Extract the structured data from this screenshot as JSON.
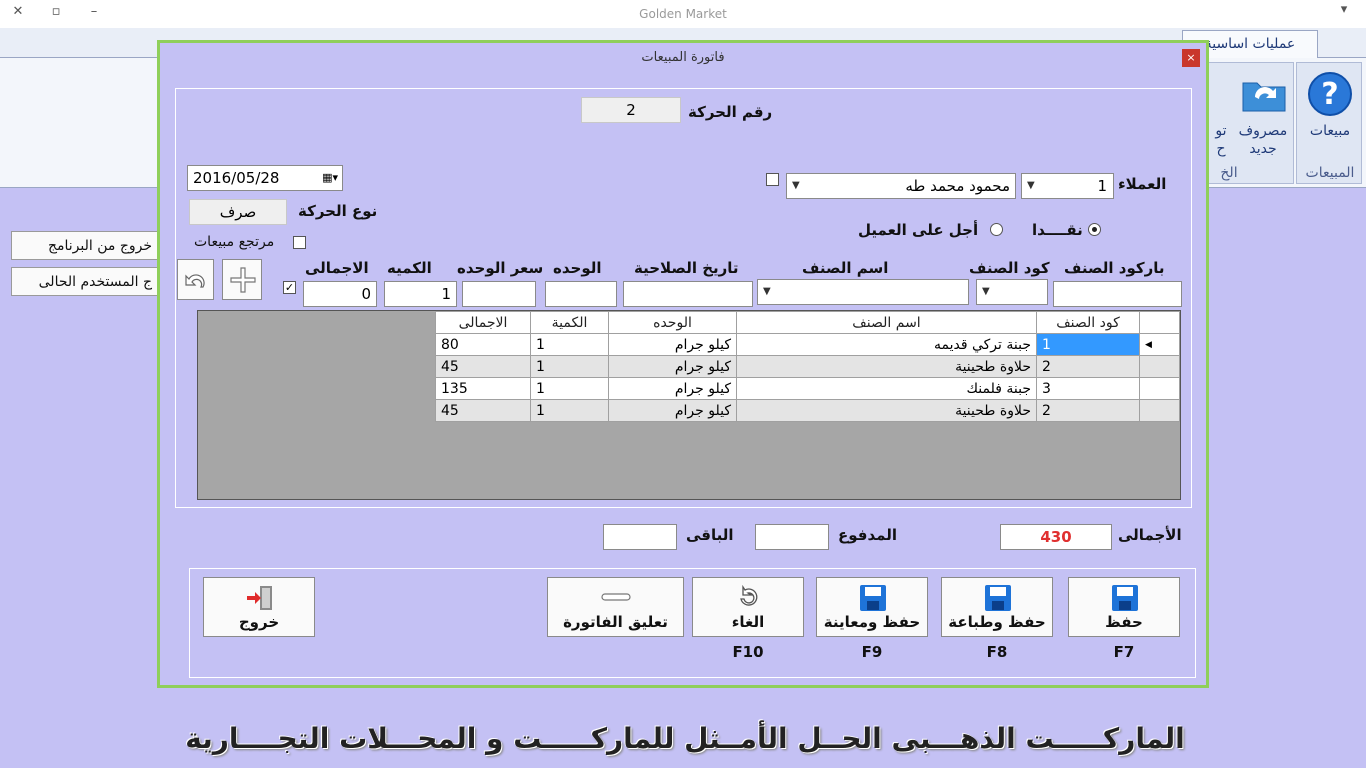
{
  "app": {
    "title": "Golden Market"
  },
  "ribbon": {
    "tab_basic": "عمليات اساسية",
    "btn_sales": "مبيعات",
    "btn_expense_line1": "مصروف",
    "btn_expense_line2": "جديد",
    "btn_partial_line1": "تو",
    "btn_partial_line2": "ح",
    "group_sales": "المبيعات",
    "group_partial": "الخ"
  },
  "side": {
    "exit_program": "خروج من البرنامج",
    "exit_user": "ج المستخدم الحالى"
  },
  "footer_banner": "الماركـــــت الذهـــبى الحــل الأمــثل للماركـــــت و المحـــلات التجــــارية",
  "dialog": {
    "title": "فاتورة المبيعات",
    "close": "×",
    "txn_number_label": "رقم الحركة",
    "txn_number": "2",
    "date": "2016/05/28",
    "customers_label": "العملاء",
    "customer_code": "1",
    "customer_name": "محمود محمد طه",
    "txn_type_label": "نوع الحركة",
    "txn_type": "صرف",
    "sales_return_label": "مرتجع مبيعات",
    "cash_label": "نقــــدا",
    "credit_label": "أجل على العميل",
    "item_entry": {
      "barcode_label": "باركود الصنف",
      "code_label": "كود الصنف",
      "name_label": "اسم الصنف",
      "expiry_label": "تاريخ الصلاحية",
      "unit_label": "الوحده",
      "unit_price_label": "سعر الوحده",
      "qty_label": "الكميه",
      "total_label": "الاجمالى",
      "qty_value": "1",
      "total_value": "0"
    },
    "grid": {
      "headers": [
        "كود الصنف",
        "اسم الصنف",
        "الوحده",
        "الكمية",
        "الاجمالى"
      ],
      "rows": [
        {
          "code": "1",
          "name": "جبنة تركي قديمه",
          "unit": "كيلو جرام",
          "qty": "1",
          "total": "80"
        },
        {
          "code": "2",
          "name": "حلاوة طحينية",
          "unit": "كيلو جرام",
          "qty": "1",
          "total": "45"
        },
        {
          "code": "3",
          "name": "جبنة فلمنك",
          "unit": "كيلو جرام",
          "qty": "1",
          "total": "135"
        },
        {
          "code": "2",
          "name": "حلاوة طحينية",
          "unit": "كيلو جرام",
          "qty": "1",
          "total": "45"
        }
      ]
    },
    "totals": {
      "total_label": "الأجمالى",
      "total_value": "430",
      "paid_label": "المدفوع",
      "paid_value": "",
      "remaining_label": "الباقى",
      "remaining_value": ""
    },
    "buttons": {
      "save": "حفظ",
      "save_print": "حفظ وطباعة",
      "save_preview": "حفظ ومعاينة",
      "cancel": "الغاء",
      "suspend": "تعليق الفاتورة",
      "exit": "خروج"
    },
    "fkeys": {
      "save": "F7",
      "save_print": "F8",
      "save_preview": "F9",
      "cancel": "F10"
    }
  },
  "colors": {
    "total_value": "#e03030",
    "selected_cell": "#3399ff",
    "accent_border": "#8fcf5a"
  }
}
